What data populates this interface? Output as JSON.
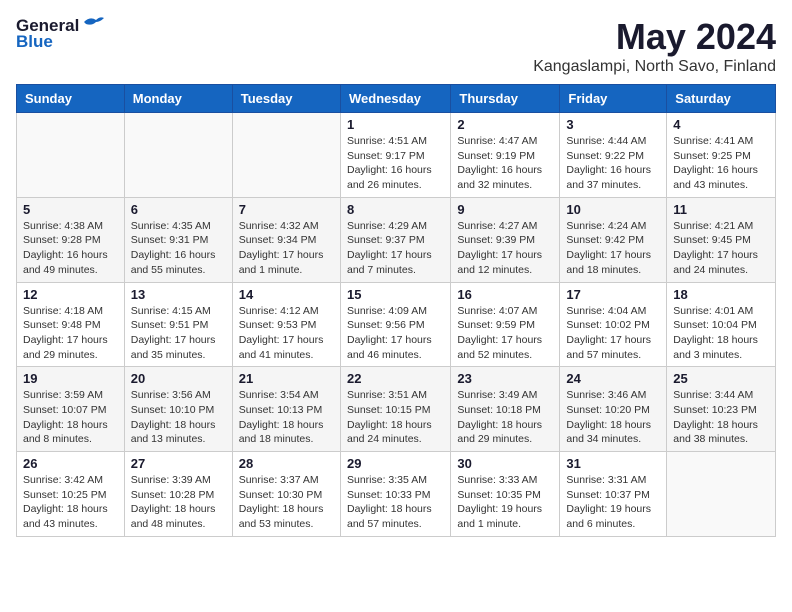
{
  "header": {
    "logo_general": "General",
    "logo_blue": "Blue",
    "main_title": "May 2024",
    "subtitle": "Kangaslampi, North Savo, Finland"
  },
  "days_of_week": [
    "Sunday",
    "Monday",
    "Tuesday",
    "Wednesday",
    "Thursday",
    "Friday",
    "Saturday"
  ],
  "weeks": [
    [
      {
        "day": "",
        "info": ""
      },
      {
        "day": "",
        "info": ""
      },
      {
        "day": "",
        "info": ""
      },
      {
        "day": "1",
        "info": "Sunrise: 4:51 AM\nSunset: 9:17 PM\nDaylight: 16 hours\nand 26 minutes."
      },
      {
        "day": "2",
        "info": "Sunrise: 4:47 AM\nSunset: 9:19 PM\nDaylight: 16 hours\nand 32 minutes."
      },
      {
        "day": "3",
        "info": "Sunrise: 4:44 AM\nSunset: 9:22 PM\nDaylight: 16 hours\nand 37 minutes."
      },
      {
        "day": "4",
        "info": "Sunrise: 4:41 AM\nSunset: 9:25 PM\nDaylight: 16 hours\nand 43 minutes."
      }
    ],
    [
      {
        "day": "5",
        "info": "Sunrise: 4:38 AM\nSunset: 9:28 PM\nDaylight: 16 hours\nand 49 minutes."
      },
      {
        "day": "6",
        "info": "Sunrise: 4:35 AM\nSunset: 9:31 PM\nDaylight: 16 hours\nand 55 minutes."
      },
      {
        "day": "7",
        "info": "Sunrise: 4:32 AM\nSunset: 9:34 PM\nDaylight: 17 hours\nand 1 minute."
      },
      {
        "day": "8",
        "info": "Sunrise: 4:29 AM\nSunset: 9:37 PM\nDaylight: 17 hours\nand 7 minutes."
      },
      {
        "day": "9",
        "info": "Sunrise: 4:27 AM\nSunset: 9:39 PM\nDaylight: 17 hours\nand 12 minutes."
      },
      {
        "day": "10",
        "info": "Sunrise: 4:24 AM\nSunset: 9:42 PM\nDaylight: 17 hours\nand 18 minutes."
      },
      {
        "day": "11",
        "info": "Sunrise: 4:21 AM\nSunset: 9:45 PM\nDaylight: 17 hours\nand 24 minutes."
      }
    ],
    [
      {
        "day": "12",
        "info": "Sunrise: 4:18 AM\nSunset: 9:48 PM\nDaylight: 17 hours\nand 29 minutes."
      },
      {
        "day": "13",
        "info": "Sunrise: 4:15 AM\nSunset: 9:51 PM\nDaylight: 17 hours\nand 35 minutes."
      },
      {
        "day": "14",
        "info": "Sunrise: 4:12 AM\nSunset: 9:53 PM\nDaylight: 17 hours\nand 41 minutes."
      },
      {
        "day": "15",
        "info": "Sunrise: 4:09 AM\nSunset: 9:56 PM\nDaylight: 17 hours\nand 46 minutes."
      },
      {
        "day": "16",
        "info": "Sunrise: 4:07 AM\nSunset: 9:59 PM\nDaylight: 17 hours\nand 52 minutes."
      },
      {
        "day": "17",
        "info": "Sunrise: 4:04 AM\nSunset: 10:02 PM\nDaylight: 17 hours\nand 57 minutes."
      },
      {
        "day": "18",
        "info": "Sunrise: 4:01 AM\nSunset: 10:04 PM\nDaylight: 18 hours\nand 3 minutes."
      }
    ],
    [
      {
        "day": "19",
        "info": "Sunrise: 3:59 AM\nSunset: 10:07 PM\nDaylight: 18 hours\nand 8 minutes."
      },
      {
        "day": "20",
        "info": "Sunrise: 3:56 AM\nSunset: 10:10 PM\nDaylight: 18 hours\nand 13 minutes."
      },
      {
        "day": "21",
        "info": "Sunrise: 3:54 AM\nSunset: 10:13 PM\nDaylight: 18 hours\nand 18 minutes."
      },
      {
        "day": "22",
        "info": "Sunrise: 3:51 AM\nSunset: 10:15 PM\nDaylight: 18 hours\nand 24 minutes."
      },
      {
        "day": "23",
        "info": "Sunrise: 3:49 AM\nSunset: 10:18 PM\nDaylight: 18 hours\nand 29 minutes."
      },
      {
        "day": "24",
        "info": "Sunrise: 3:46 AM\nSunset: 10:20 PM\nDaylight: 18 hours\nand 34 minutes."
      },
      {
        "day": "25",
        "info": "Sunrise: 3:44 AM\nSunset: 10:23 PM\nDaylight: 18 hours\nand 38 minutes."
      }
    ],
    [
      {
        "day": "26",
        "info": "Sunrise: 3:42 AM\nSunset: 10:25 PM\nDaylight: 18 hours\nand 43 minutes."
      },
      {
        "day": "27",
        "info": "Sunrise: 3:39 AM\nSunset: 10:28 PM\nDaylight: 18 hours\nand 48 minutes."
      },
      {
        "day": "28",
        "info": "Sunrise: 3:37 AM\nSunset: 10:30 PM\nDaylight: 18 hours\nand 53 minutes."
      },
      {
        "day": "29",
        "info": "Sunrise: 3:35 AM\nSunset: 10:33 PM\nDaylight: 18 hours\nand 57 minutes."
      },
      {
        "day": "30",
        "info": "Sunrise: 3:33 AM\nSunset: 10:35 PM\nDaylight: 19 hours\nand 1 minute."
      },
      {
        "day": "31",
        "info": "Sunrise: 3:31 AM\nSunset: 10:37 PM\nDaylight: 19 hours\nand 6 minutes."
      },
      {
        "day": "",
        "info": ""
      }
    ]
  ]
}
